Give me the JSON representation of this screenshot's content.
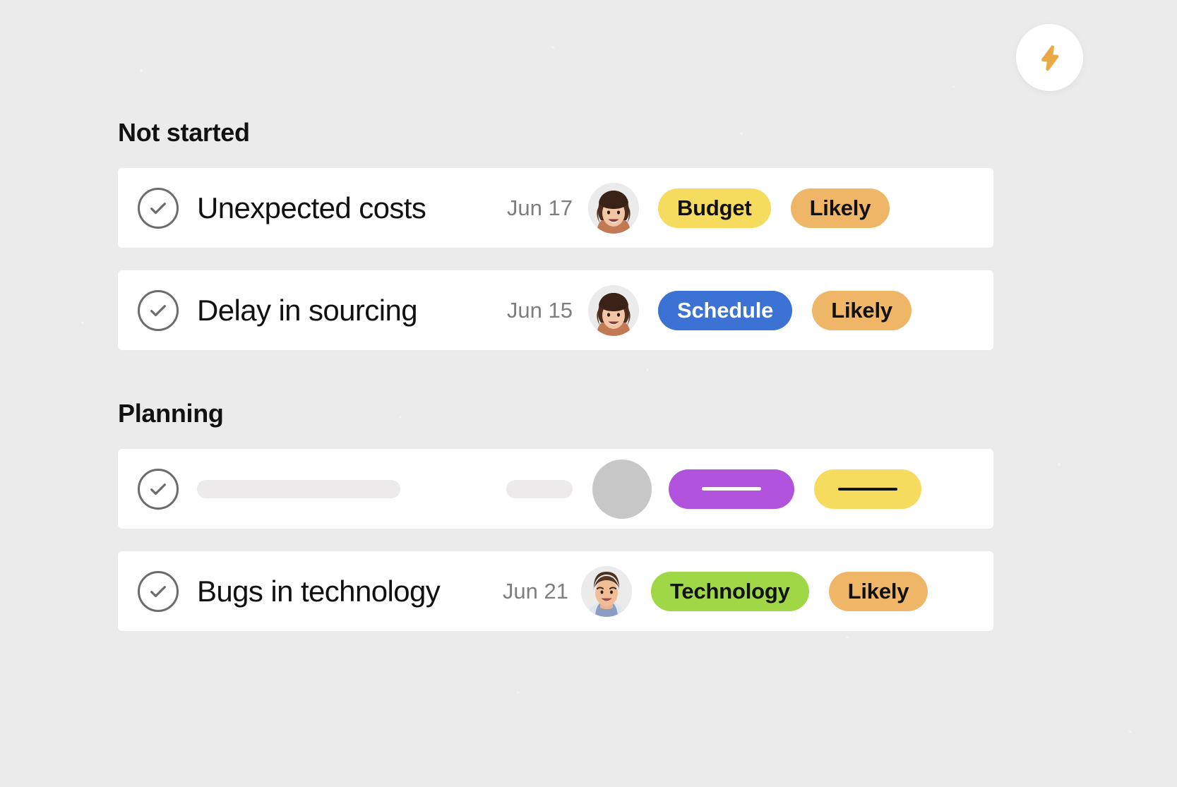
{
  "header": {
    "bolt_icon": "lightning-bolt-icon",
    "bolt_color": "#E9A945",
    "bolt_bg": "#FFFFFF"
  },
  "background_color": "#ECEBEB",
  "groups": [
    {
      "title": "Not started",
      "rows": [
        {
          "check_icon": "circle-check-icon",
          "title": "Unexpected costs",
          "date": "Jun 17",
          "avatar": "avatar-woman-brown-hair",
          "tags": [
            {
              "label": "Budget",
              "bg": "#F5DC5E",
              "fg": "#111111"
            },
            {
              "label": "Likely",
              "bg": "#F0B667",
              "fg": "#111111"
            }
          ]
        },
        {
          "check_icon": "circle-check-icon",
          "title": "Delay in sourcing",
          "date": "Jun 15",
          "avatar": "avatar-woman-brown-hair",
          "tags": [
            {
              "label": "Schedule",
              "bg": "#3B72D4",
              "fg": "#FFFFFF"
            },
            {
              "label": "Likely",
              "bg": "#F0B667",
              "fg": "#111111"
            }
          ]
        }
      ]
    },
    {
      "title": "Planning",
      "rows": [
        {
          "check_icon": "circle-check-icon",
          "placeholder": true,
          "skeleton_bar_color": "#ECEAEA",
          "skeleton_avatar_color": "#C8C7C7",
          "tags": [
            {
              "label": "",
              "bg": "#B153DC",
              "fg": "#FFFFFF"
            },
            {
              "label": "",
              "bg": "#F5DC5E",
              "fg": "#111111"
            }
          ]
        },
        {
          "check_icon": "circle-check-icon",
          "title": "Bugs in technology",
          "date": "Jun 21",
          "avatar": "avatar-man-brown-hair",
          "tags": [
            {
              "label": "Technology",
              "bg": "#A0D746",
              "fg": "#111111"
            },
            {
              "label": "Likely",
              "bg": "#F0B667",
              "fg": "#111111"
            }
          ]
        }
      ]
    }
  ]
}
